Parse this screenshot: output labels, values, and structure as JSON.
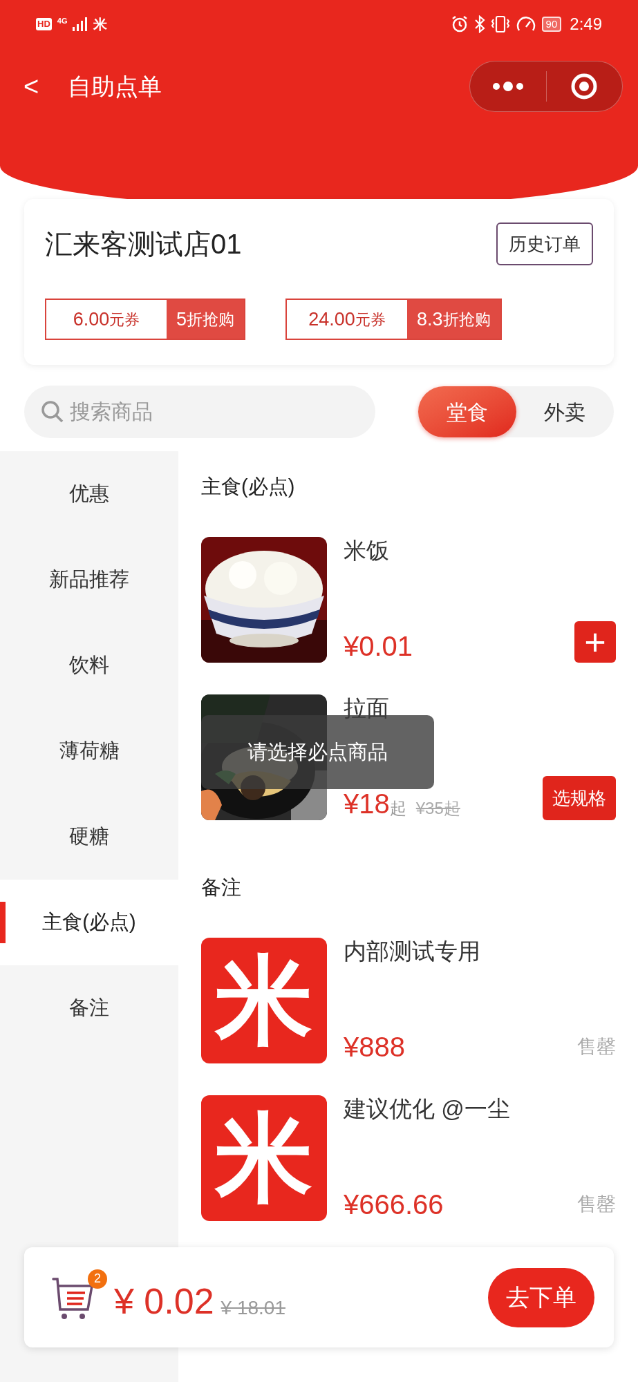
{
  "status_bar": {
    "hd": "HD",
    "network": "4G",
    "app_icon": "米",
    "battery": "90",
    "time": "2:49"
  },
  "nav": {
    "back": "<",
    "title": "自助点单"
  },
  "store": {
    "name": "汇来客测试店01",
    "history_button": "历史订单",
    "coupons": [
      {
        "amount": "6.00",
        "unit": "元券",
        "discount": "5",
        "action": "折抢购"
      },
      {
        "amount": "24.00",
        "unit": "元券",
        "discount": "8.3",
        "action": "折抢购"
      }
    ]
  },
  "search": {
    "placeholder": "搜索商品"
  },
  "mode_tabs": [
    {
      "label": "堂食",
      "selected": true
    },
    {
      "label": "外卖",
      "selected": false
    }
  ],
  "categories": [
    {
      "label": "优惠",
      "selected": false
    },
    {
      "label": "新品推荐",
      "selected": false
    },
    {
      "label": "饮料",
      "selected": false
    },
    {
      "label": "薄荷糖",
      "selected": false
    },
    {
      "label": "硬糖",
      "selected": false
    },
    {
      "label": "主食(必点)",
      "selected": true
    },
    {
      "label": "备注",
      "selected": false
    }
  ],
  "sections": [
    {
      "title": "主食(必点)",
      "items": [
        {
          "name": "米饭",
          "price": "¥0.01",
          "action": {
            "kind": "add",
            "label": "+"
          }
        },
        {
          "name": "拉面",
          "price": "¥18",
          "price_suffix": "起",
          "original_price": "¥35起",
          "action": {
            "kind": "spec",
            "label": "选规格"
          }
        }
      ]
    },
    {
      "title": "备注",
      "items": [
        {
          "name": "内部测试专用",
          "image": {
            "kind": "logo",
            "text": "米"
          },
          "price": "¥888",
          "action": {
            "kind": "soldout",
            "label": "售罄"
          }
        },
        {
          "name": "建议优化 @一尘",
          "image": {
            "kind": "logo",
            "text": "米"
          },
          "price": "¥666.66",
          "action": {
            "kind": "soldout",
            "label": "售罄"
          }
        }
      ]
    }
  ],
  "toast": "请选择必点商品",
  "cart": {
    "count": "2",
    "total": "¥ 0.02",
    "original_total": "¥ 18.01",
    "checkout_button": "去下单"
  }
}
